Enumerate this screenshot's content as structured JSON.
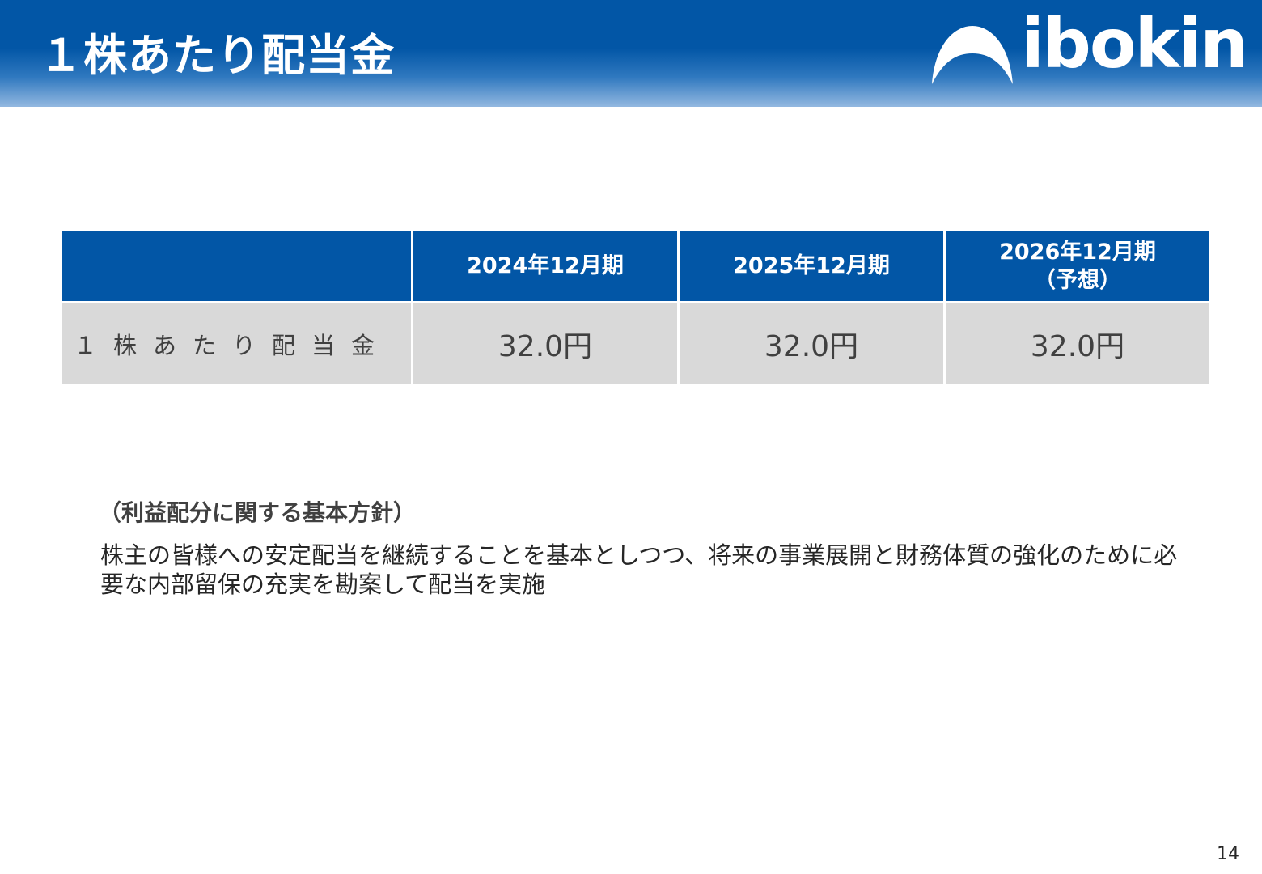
{
  "header": {
    "title": "１株あたり配当金",
    "logo_text": "ibokin"
  },
  "table": {
    "columns": [
      "",
      "2024年12月期",
      "2025年12月期",
      "2026年12月期\n（予想）"
    ],
    "rows": [
      {
        "label": "１株あたり配当金",
        "values": [
          "32.0円",
          "32.0円",
          "32.0円"
        ]
      }
    ]
  },
  "policy": {
    "heading": "（利益配分に関する基本方針）",
    "body": "株主の皆様への安定配当を継続することを基本としつつ、将来の事業展開と財務体質の強化のために必要な内部留保の充実を勘案して配当を実施"
  },
  "footer": {
    "page_number": "14"
  },
  "colors": {
    "header_blue": "#0256a6",
    "cell_gray": "#d9d9d9"
  }
}
